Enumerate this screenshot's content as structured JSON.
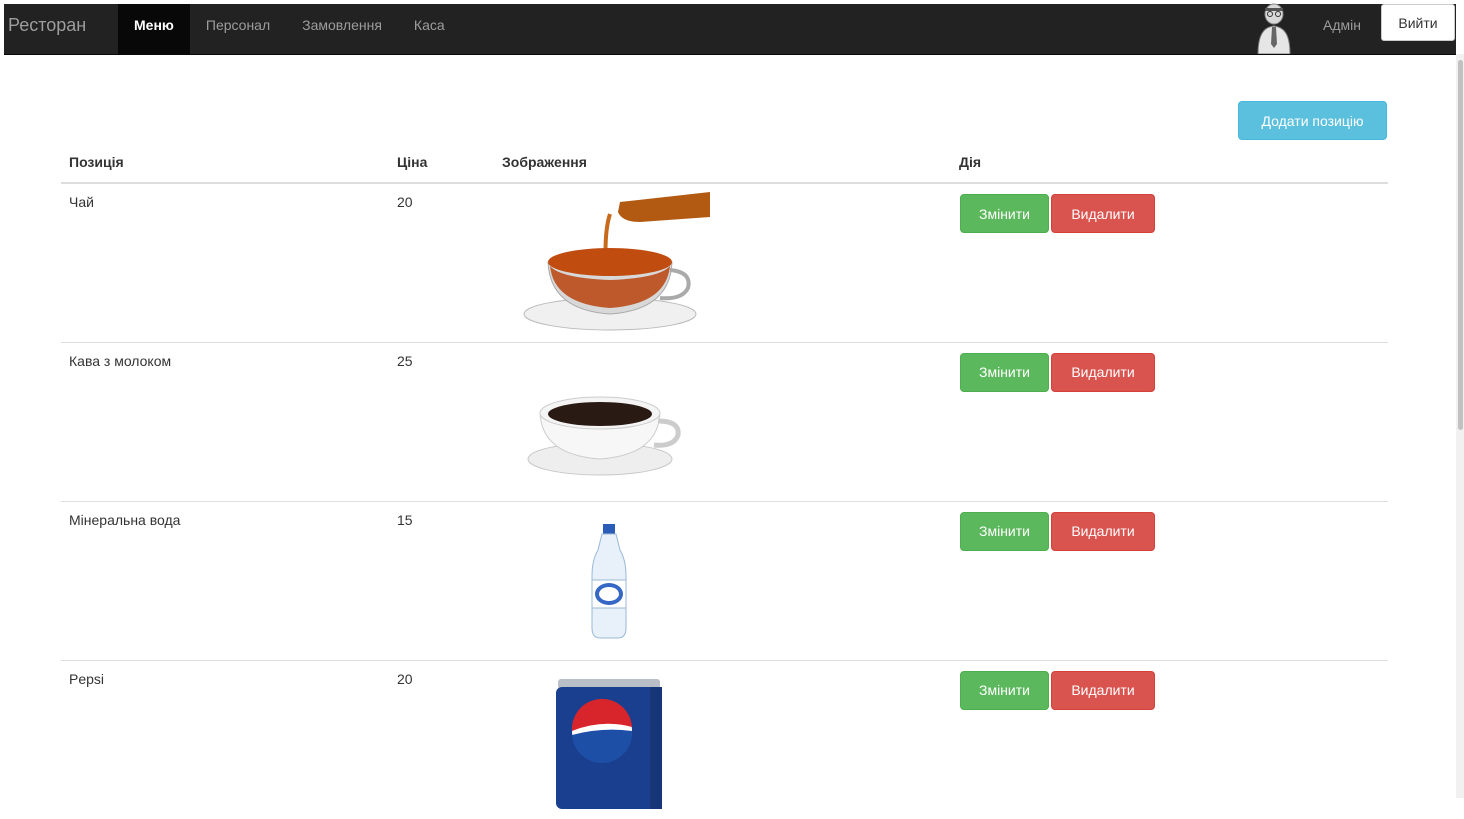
{
  "navbar": {
    "brand": "Ресторан",
    "items": [
      {
        "label": "Меню",
        "active": true
      },
      {
        "label": "Персонал",
        "active": false
      },
      {
        "label": "Замовлення",
        "active": false
      },
      {
        "label": "Каса",
        "active": false
      }
    ],
    "user_name": "Адмін",
    "logout_label": "Вийти"
  },
  "toolbar": {
    "add_label": "Додати позицію"
  },
  "table": {
    "headers": {
      "name": "Позиція",
      "price": "Ціна",
      "image": "Зображення",
      "action": "Дія"
    },
    "rows": [
      {
        "name": "Чай",
        "price": "20",
        "image_icon": "tea-cup-image",
        "edit_label": "Змінити",
        "delete_label": "Видалити"
      },
      {
        "name": "Кава з молоком",
        "price": "25",
        "image_icon": "coffee-cup-image",
        "edit_label": "Змінити",
        "delete_label": "Видалити"
      },
      {
        "name": "Мінеральна вода",
        "price": "15",
        "image_icon": "water-bottle-image",
        "edit_label": "Змінити",
        "delete_label": "Видалити"
      },
      {
        "name": "Pepsi",
        "price": "20",
        "image_icon": "pepsi-can-image",
        "edit_label": "Змінити",
        "delete_label": "Видалити"
      }
    ]
  },
  "colors": {
    "navbar_bg": "#222222",
    "info": "#5bc0de",
    "success": "#5cb85c",
    "danger": "#d9534f"
  }
}
